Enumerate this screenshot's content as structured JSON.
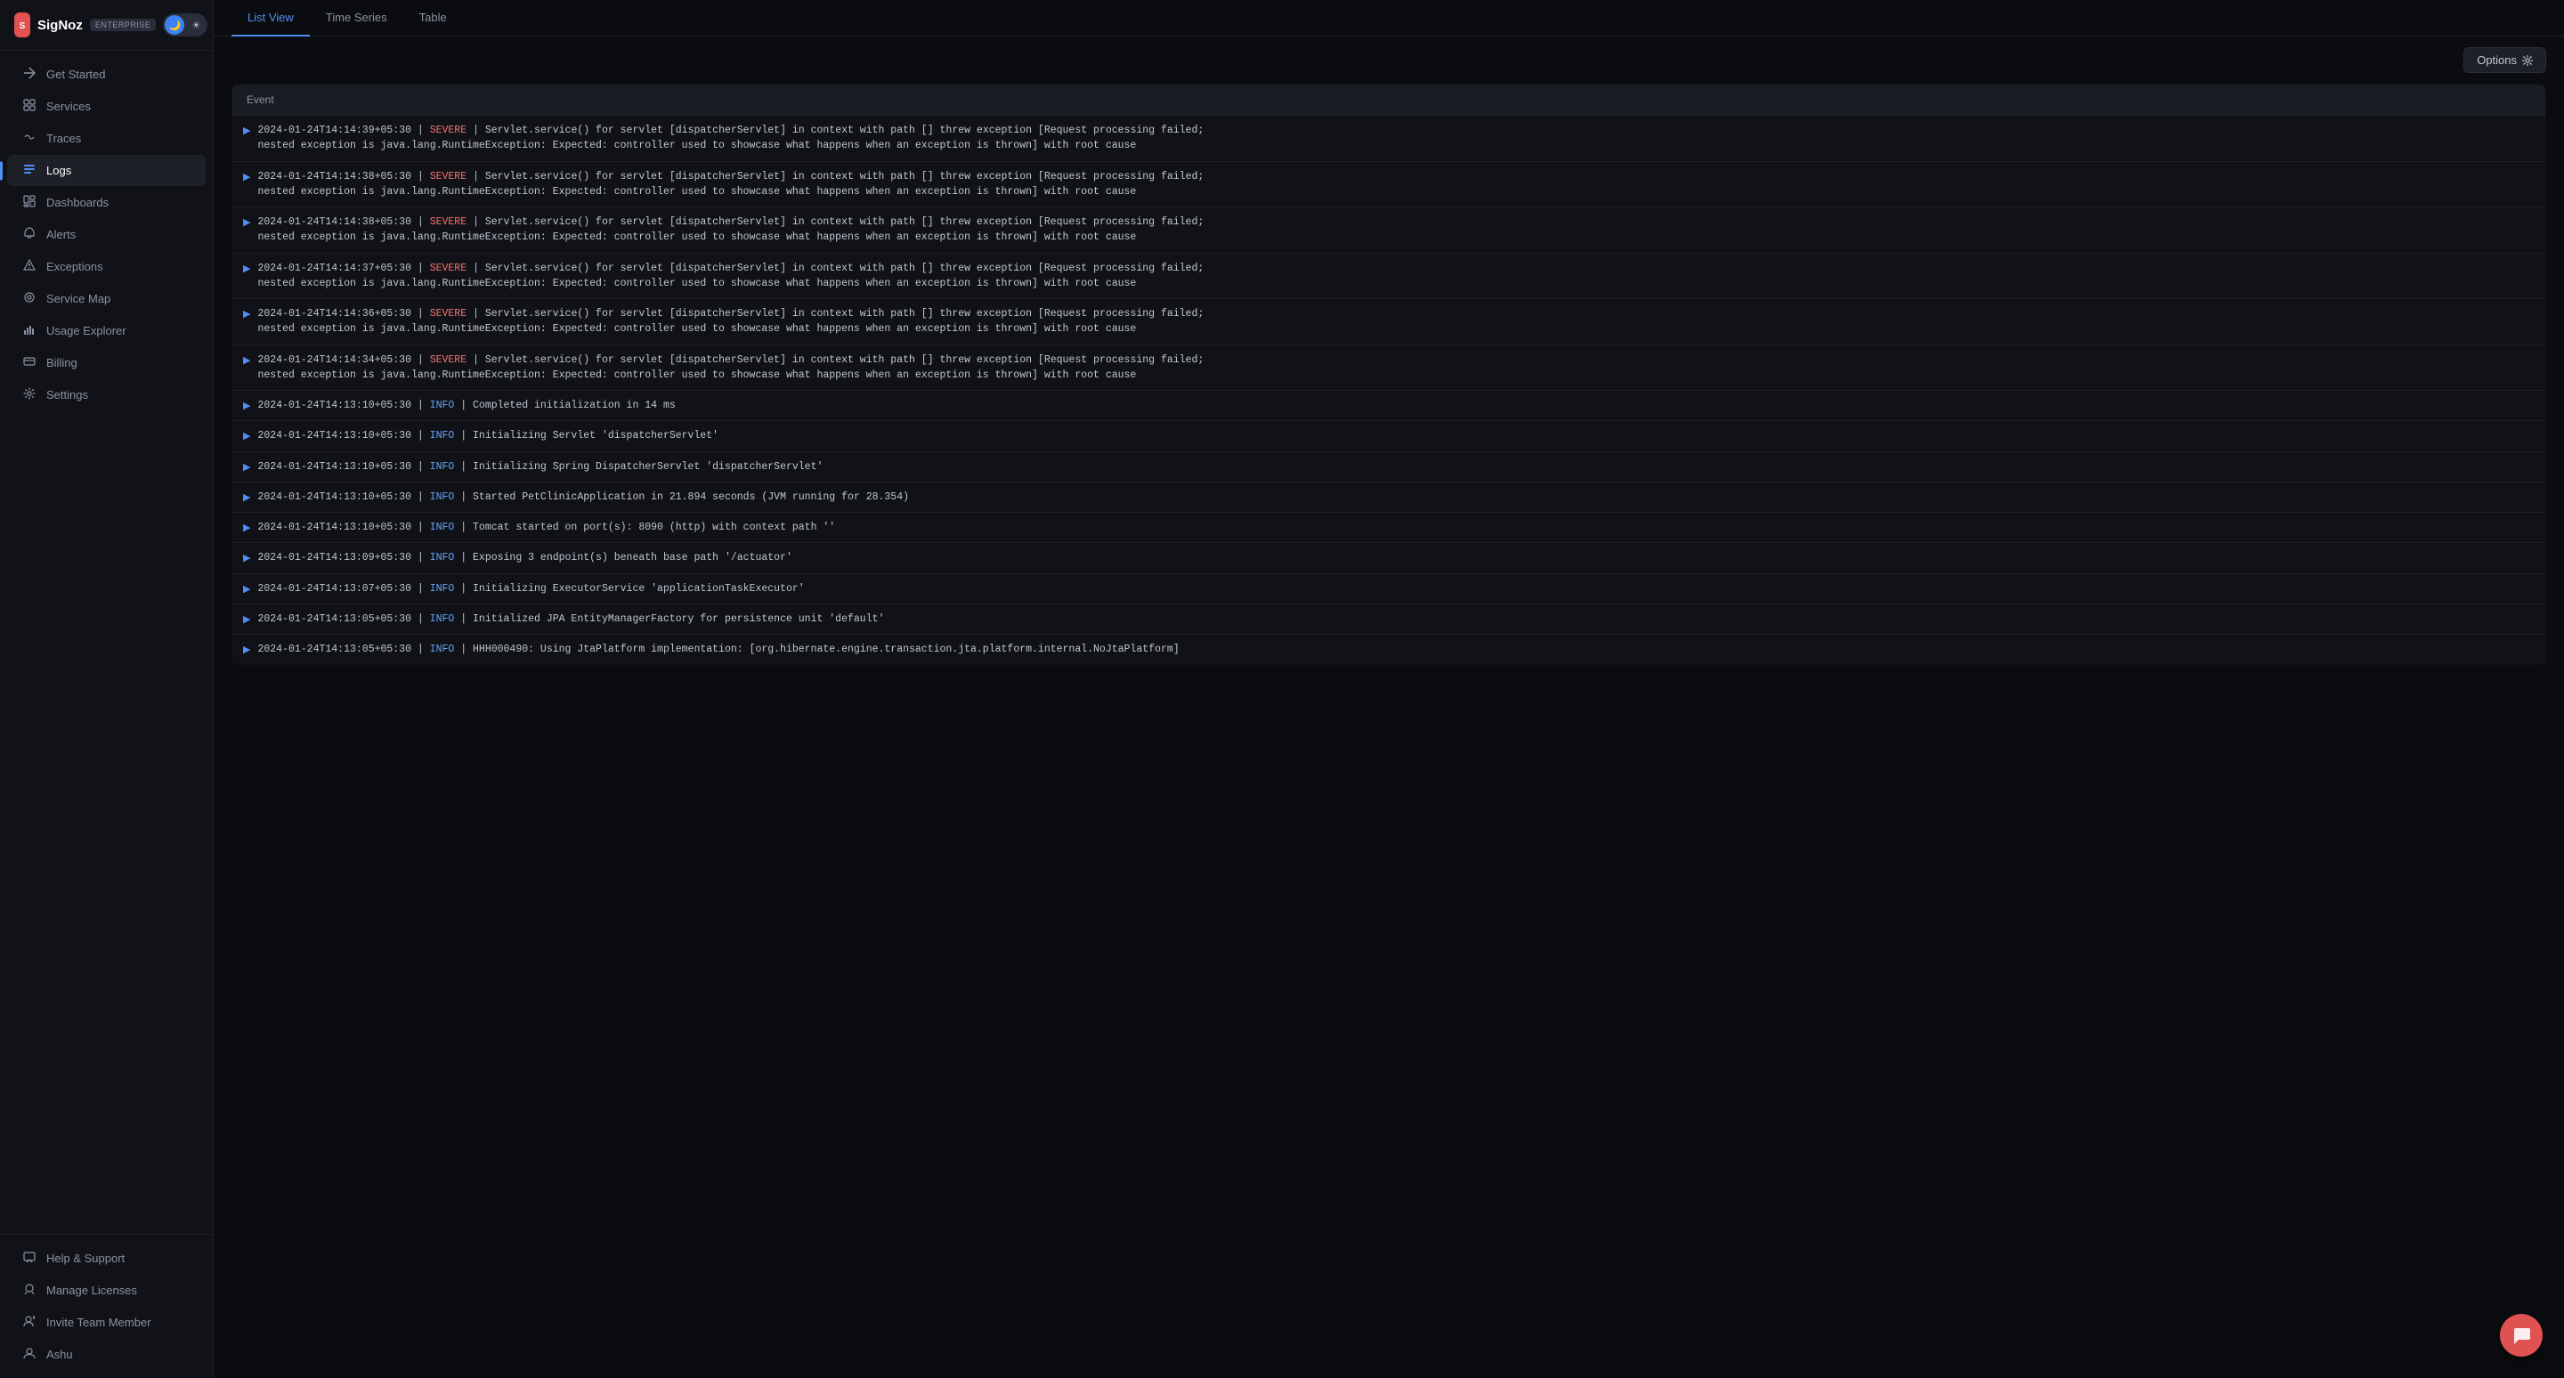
{
  "app": {
    "name": "SigNoz",
    "badge": "ENTERPRISE",
    "logo_letter": "S"
  },
  "theme": {
    "dark_label": "🌙",
    "light_label": "☀"
  },
  "sidebar": {
    "top_items": [
      {
        "id": "get-started",
        "label": "Get Started",
        "icon": "✦",
        "active": false
      },
      {
        "id": "services",
        "label": "Services",
        "icon": "◈",
        "active": false
      },
      {
        "id": "traces",
        "label": "Traces",
        "icon": "⟡",
        "active": false
      },
      {
        "id": "logs",
        "label": "Logs",
        "icon": "▤",
        "active": true
      },
      {
        "id": "dashboards",
        "label": "Dashboards",
        "icon": "▦",
        "active": false
      },
      {
        "id": "alerts",
        "label": "Alerts",
        "icon": "🔔",
        "active": false
      },
      {
        "id": "exceptions",
        "label": "Exceptions",
        "icon": "⚠",
        "active": false
      },
      {
        "id": "service-map",
        "label": "Service Map",
        "icon": "◎",
        "active": false
      },
      {
        "id": "usage-explorer",
        "label": "Usage Explorer",
        "icon": "📊",
        "active": false
      },
      {
        "id": "billing",
        "label": "Billing",
        "icon": "▤",
        "active": false
      },
      {
        "id": "settings",
        "label": "Settings",
        "icon": "⚙",
        "active": false
      }
    ],
    "bottom_items": [
      {
        "id": "help-support",
        "label": "Help & Support",
        "icon": "💬"
      },
      {
        "id": "manage-licenses",
        "label": "Manage Licenses",
        "icon": "🔑"
      },
      {
        "id": "invite-team",
        "label": "Invite Team Member",
        "icon": "👤"
      },
      {
        "id": "ashu",
        "label": "Ashu",
        "icon": "👤"
      }
    ]
  },
  "tabs": [
    {
      "id": "list-view",
      "label": "List View",
      "active": true
    },
    {
      "id": "time-series",
      "label": "Time Series",
      "active": false
    },
    {
      "id": "table",
      "label": "Table",
      "active": false
    }
  ],
  "toolbar": {
    "options_label": "Options",
    "options_icon": "⚙"
  },
  "table": {
    "column_header": "Event"
  },
  "logs": [
    {
      "id": 1,
      "line1": "2024-01-24T14:14:39+05:30 | SEVERE | Servlet.service() for servlet [dispatcherServlet] in context with path [] threw exception [Request processing failed;",
      "line2": "nested exception is java.lang.RuntimeException: Expected: controller used to showcase what happens when an exception is thrown] with root cause"
    },
    {
      "id": 2,
      "line1": "2024-01-24T14:14:38+05:30 | SEVERE | Servlet.service() for servlet [dispatcherServlet] in context with path [] threw exception [Request processing failed;",
      "line2": "nested exception is java.lang.RuntimeException: Expected: controller used to showcase what happens when an exception is thrown] with root cause"
    },
    {
      "id": 3,
      "line1": "2024-01-24T14:14:38+05:30 | SEVERE | Servlet.service() for servlet [dispatcherServlet] in context with path [] threw exception [Request processing failed;",
      "line2": "nested exception is java.lang.RuntimeException: Expected: controller used to showcase what happens when an exception is thrown] with root cause"
    },
    {
      "id": 4,
      "line1": "2024-01-24T14:14:37+05:30 | SEVERE | Servlet.service() for servlet [dispatcherServlet] in context with path [] threw exception [Request processing failed;",
      "line2": "nested exception is java.lang.RuntimeException: Expected: controller used to showcase what happens when an exception is thrown] with root cause"
    },
    {
      "id": 5,
      "line1": "2024-01-24T14:14:36+05:30 | SEVERE | Servlet.service() for servlet [dispatcherServlet] in context with path [] threw exception [Request processing failed;",
      "line2": "nested exception is java.lang.RuntimeException: Expected: controller used to showcase what happens when an exception is thrown] with root cause"
    },
    {
      "id": 6,
      "line1": "2024-01-24T14:14:34+05:30 | SEVERE | Servlet.service() for servlet [dispatcherServlet] in context with path [] threw exception [Request processing failed;",
      "line2": "nested exception is java.lang.RuntimeException: Expected: controller used to showcase what happens when an exception is thrown] with root cause"
    },
    {
      "id": 7,
      "line1": "2024-01-24T14:13:10+05:30 | INFO | Completed initialization in 14 ms",
      "line2": ""
    },
    {
      "id": 8,
      "line1": "2024-01-24T14:13:10+05:30 | INFO | Initializing Servlet 'dispatcherServlet'",
      "line2": ""
    },
    {
      "id": 9,
      "line1": "2024-01-24T14:13:10+05:30 | INFO | Initializing Spring DispatcherServlet 'dispatcherServlet'",
      "line2": ""
    },
    {
      "id": 10,
      "line1": "2024-01-24T14:13:10+05:30 | INFO | Started PetClinicApplication in 21.894 seconds (JVM running for 28.354)",
      "line2": ""
    },
    {
      "id": 11,
      "line1": "2024-01-24T14:13:10+05:30 | INFO | Tomcat started on port(s): 8090 (http) with context path ''",
      "line2": ""
    },
    {
      "id": 12,
      "line1": "2024-01-24T14:13:09+05:30 | INFO | Exposing 3 endpoint(s) beneath base path '/actuator'",
      "line2": ""
    },
    {
      "id": 13,
      "line1": "2024-01-24T14:13:07+05:30 | INFO | Initializing ExecutorService 'applicationTaskExecutor'",
      "line2": ""
    },
    {
      "id": 14,
      "line1": "2024-01-24T14:13:05+05:30 | INFO | Initialized JPA EntityManagerFactory for persistence unit 'default'",
      "line2": ""
    },
    {
      "id": 15,
      "line1": "2024-01-24T14:13:05+05:30 | INFO | HHH000490: Using JtaPlatform implementation: [org.hibernate.engine.transaction.jta.platform.internal.NoJtaPlatform]",
      "line2": ""
    }
  ]
}
